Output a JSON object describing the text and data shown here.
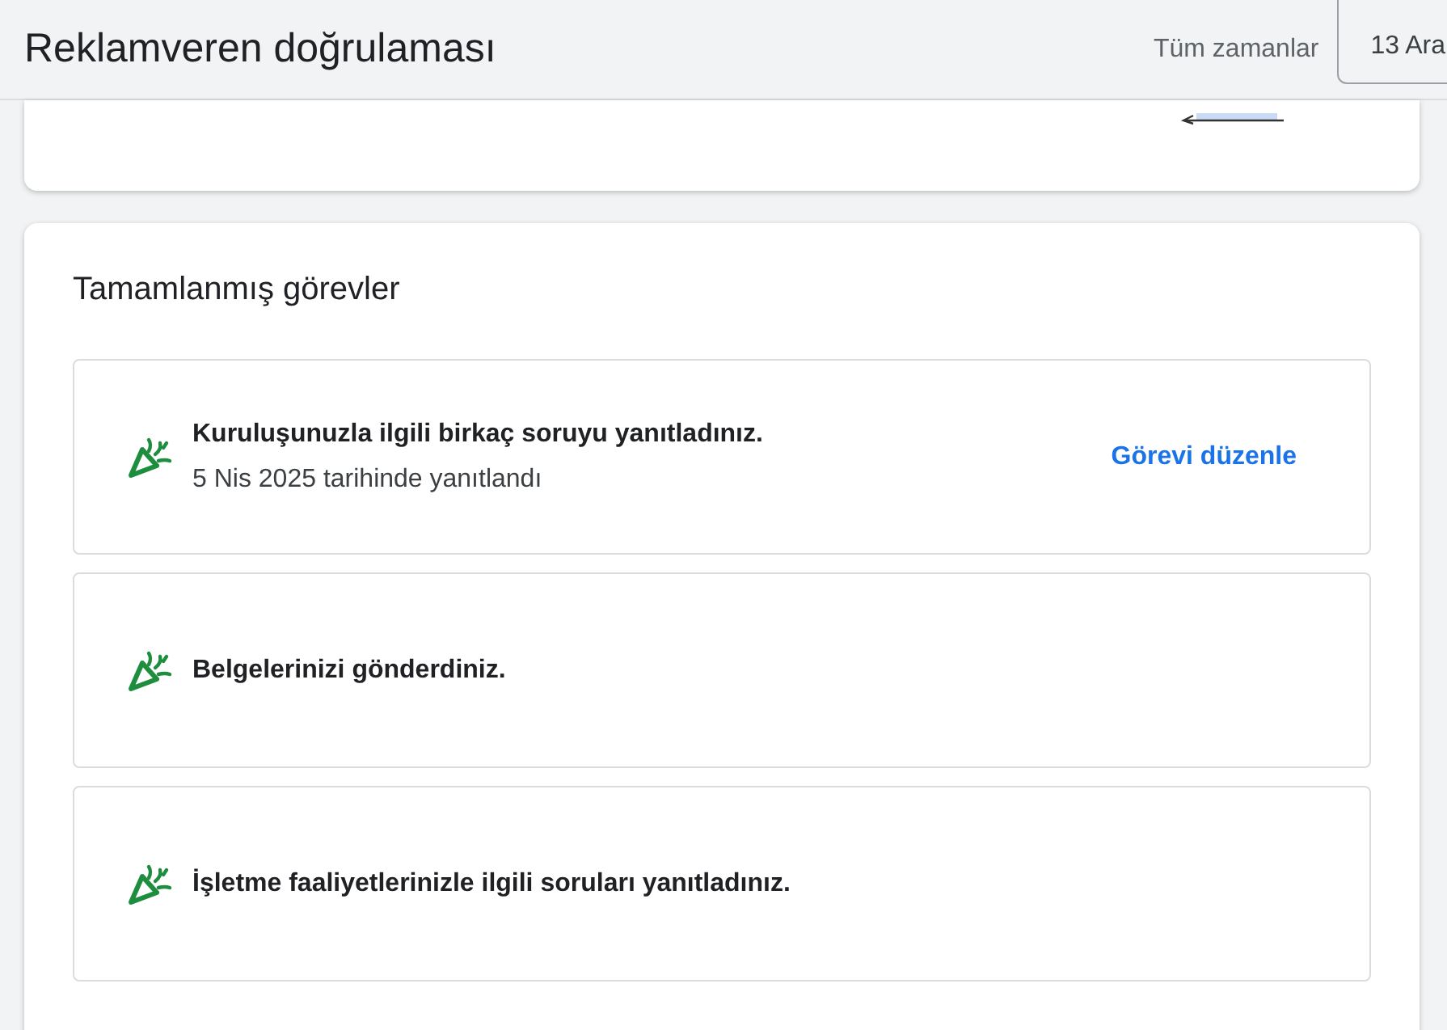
{
  "header": {
    "title": "Reklamveren doğrulaması",
    "range_label": "Tüm zamanlar",
    "date_button": "13 Ara"
  },
  "completed": {
    "heading": "Tamamlanmış görevler",
    "tasks": [
      {
        "title": "Kuruluşunuzla ilgili birkaç soruyu yanıtladınız.",
        "subtitle": "5 Nis 2025 tarihinde yanıtlandı",
        "action": "Görevi düzenle"
      },
      {
        "title": "Belgelerinizi gönderdiniz."
      },
      {
        "title": "İşletme faaliyetlerinizle ilgili soruları yanıtladınız."
      }
    ]
  }
}
